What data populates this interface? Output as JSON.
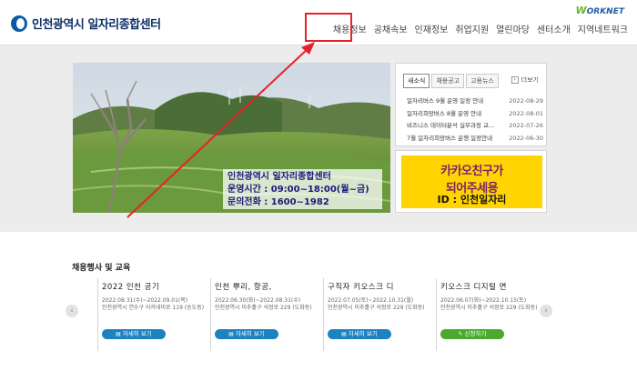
{
  "header": {
    "logo_text": "인천광역시 일자리종합센터",
    "worknet_prefix": "W",
    "worknet_rest": "ORKNET",
    "nav": [
      "채용정보",
      "공채속보",
      "인재정보",
      "취업지원",
      "열린마당",
      "센터소개",
      "지역네트워크"
    ]
  },
  "banner": {
    "line1": "인천광역시 일자리종합센터",
    "line2": "운영시간 : 09:00~18:00(월~금)",
    "line3": "문의전화 : 1600~1982"
  },
  "notice": {
    "tabs": [
      "새소식",
      "채용공고",
      "고용뉴스"
    ],
    "more_label": "더보기",
    "items": [
      {
        "title": "일자리버스 9월 운영 일정 안내",
        "date": "2022-08-29"
      },
      {
        "title": "일자리희망버스 8월 운영 안내",
        "date": "2022-08-01"
      },
      {
        "title": "비즈니스 데이터분석 실무과정 교...",
        "date": "2022-07-26"
      },
      {
        "title": "7월 일자리희망버스 운행 일정안내",
        "date": "2022-06-30"
      }
    ]
  },
  "kakao": {
    "line1": "카카오친구가",
    "line2": "되어주세용",
    "id_text": "ID : 인천일자리"
  },
  "events": {
    "title": "채용행사 및 교육",
    "cards": [
      {
        "title": "2022 인천 공기",
        "date": "2022.08.31(수)~2022.09.01(목)",
        "place": "인천광역시 연수구 아카데미로 119 (송도동)",
        "button": "자세히 보기"
      },
      {
        "title": "인천 뿌리, 항공,",
        "date": "2022.06.30(화)~2022.08.31(수)",
        "place": "인천광역시 미추홀구 석정로 229 (도화동)",
        "button": "자세히 보기"
      },
      {
        "title": "구직자 키오스크 디",
        "date": "2022.07.05(토)~2022.10.31(월)",
        "place": "인천광역시 미추홀구 석정로 229 (도화동)",
        "button": "자세히 보기"
      },
      {
        "title": "키오스크 디지털 면",
        "date": "2022.06.07(화)~2022.10.15(토)",
        "place": "인천광역시 미추홀구 석정로 229 (도화동)",
        "button": "신청하기"
      }
    ]
  },
  "colors": {
    "annotation_red": "#e8212b",
    "kakao_yellow": "#ffd400",
    "button_blue": "#1c82c0",
    "button_green": "#4aa92e"
  }
}
